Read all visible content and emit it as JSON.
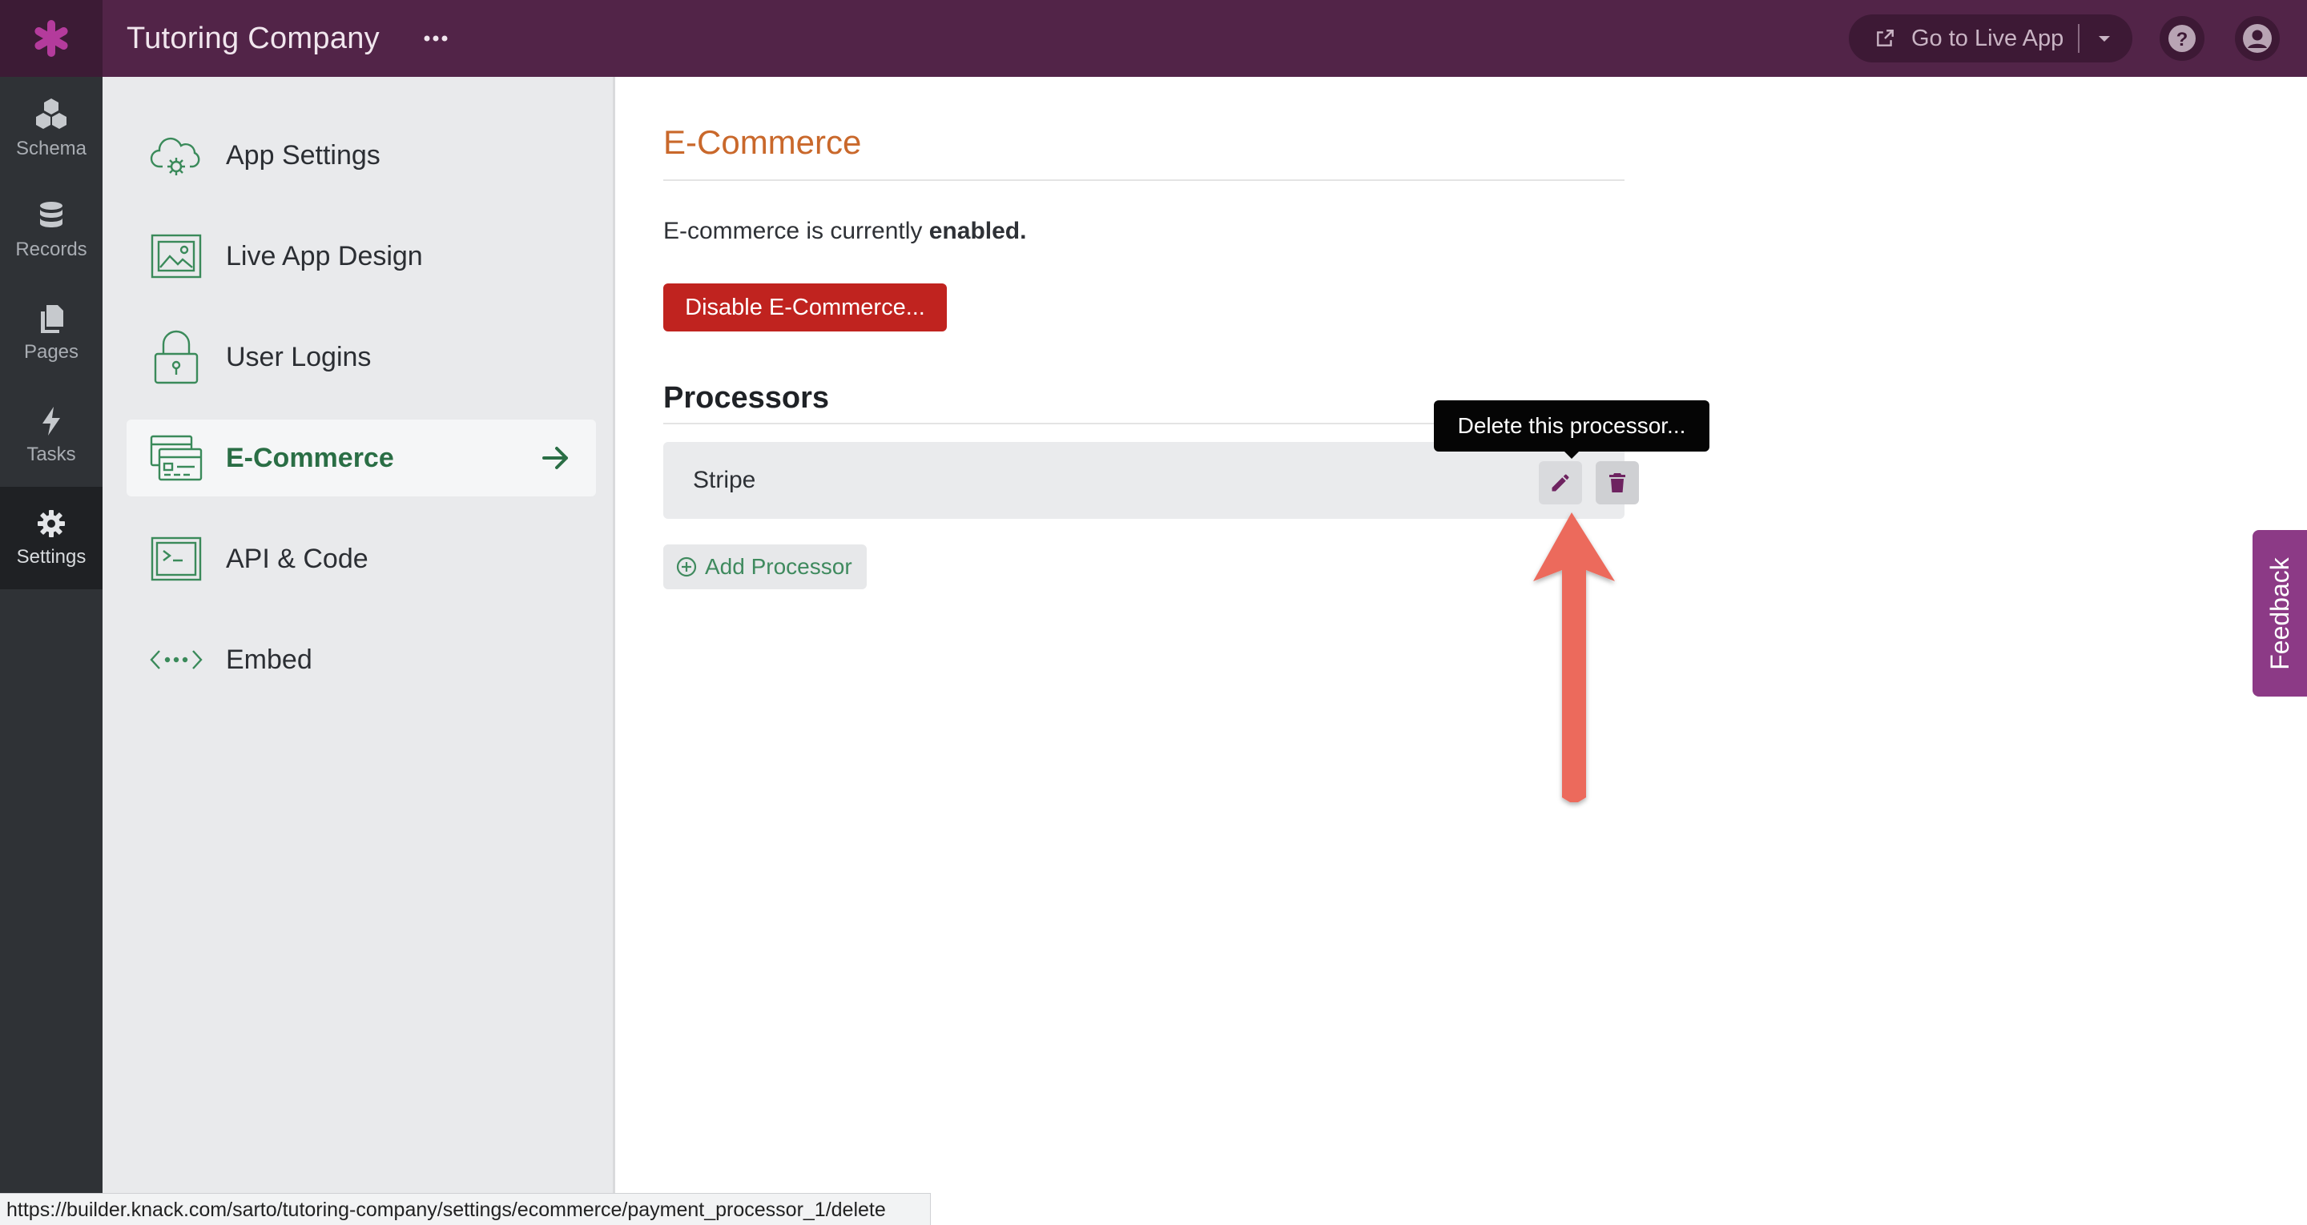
{
  "app": {
    "title": "Tutoring Company"
  },
  "header": {
    "live_app_label": "Go to Live App"
  },
  "rail": {
    "items": [
      {
        "label": "Schema",
        "icon": "schema-icon"
      },
      {
        "label": "Records",
        "icon": "database-icon"
      },
      {
        "label": "Pages",
        "icon": "pages-icon"
      },
      {
        "label": "Tasks",
        "icon": "lightning-icon"
      },
      {
        "label": "Settings",
        "icon": "gear-icon",
        "active": true
      }
    ]
  },
  "subnav": {
    "items": [
      {
        "label": "App Settings",
        "icon": "cloud-gear-icon"
      },
      {
        "label": "Live App Design",
        "icon": "picture-icon"
      },
      {
        "label": "User Logins",
        "icon": "lock-icon"
      },
      {
        "label": "E-Commerce",
        "icon": "credit-card-icon",
        "active": true
      },
      {
        "label": "API & Code",
        "icon": "terminal-icon"
      },
      {
        "label": "Embed",
        "icon": "embed-icon"
      }
    ]
  },
  "main": {
    "title": "E-Commerce",
    "status_prefix": "E-commerce is currently",
    "status_value": "enabled.",
    "disable_button": "Disable E-Commerce...",
    "processors_title": "Processors",
    "processors": [
      {
        "name": "Stripe"
      }
    ],
    "add_processor": "Add Processor"
  },
  "tooltip": {
    "text": "Delete this processor..."
  },
  "feedback": {
    "label": "Feedback"
  },
  "status_bar": {
    "url": "https://builder.knack.com/sarto/tutoring-company/settings/ecommerce/payment_processor_1/delete"
  },
  "colors": {
    "brand": "#522448",
    "accent_orange": "#c9682b",
    "danger": "#c0231f",
    "green": "#2a6e45",
    "annotation_arrow": "#ec6a5c"
  }
}
